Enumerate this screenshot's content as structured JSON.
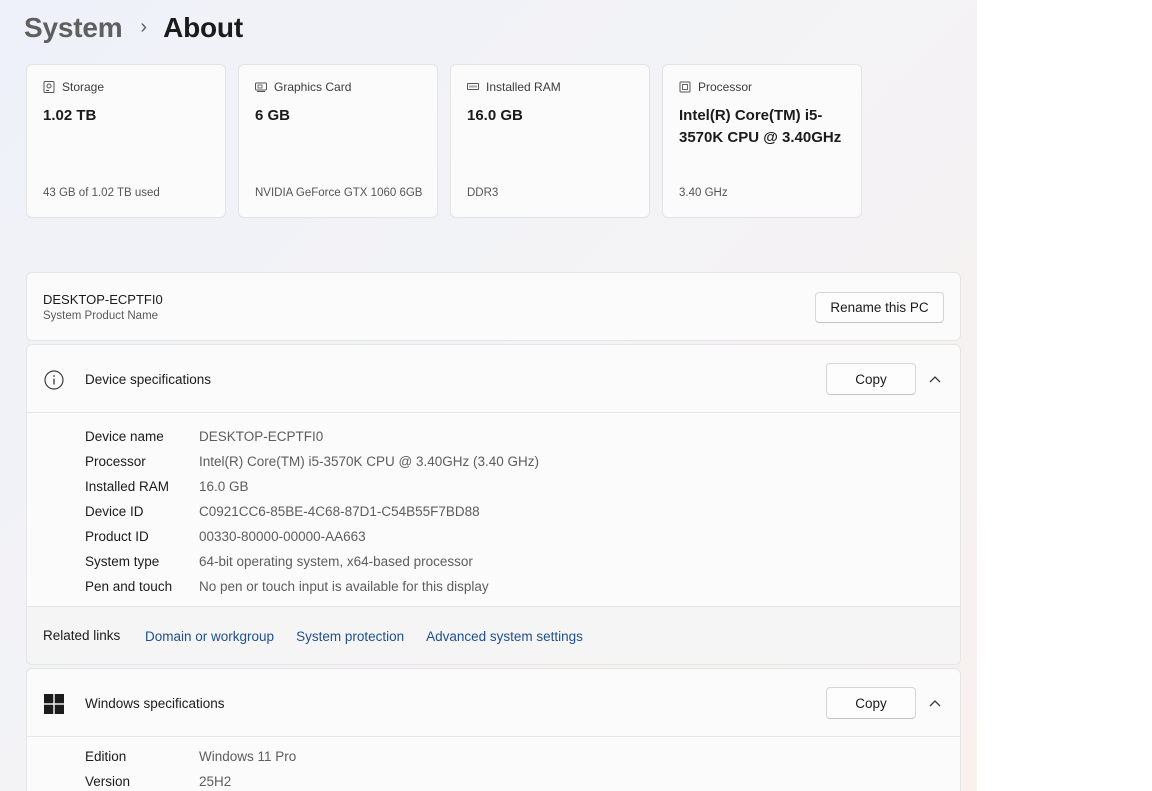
{
  "breadcrumb": {
    "parent": "System",
    "separator": "›",
    "current": "About"
  },
  "cards": [
    {
      "icon": "storage-icon",
      "label": "Storage",
      "value": "1.02 TB",
      "sub": "43 GB of 1.02 TB used"
    },
    {
      "icon": "graphics-card-icon",
      "label": "Graphics Card",
      "value": "6 GB",
      "sub": "NVIDIA GeForce GTX 1060 6GB"
    },
    {
      "icon": "ram-icon",
      "label": "Installed RAM",
      "value": "16.0 GB",
      "sub": "DDR3"
    },
    {
      "icon": "processor-icon",
      "label": "Processor",
      "value": "Intel(R) Core(TM) i5-3570K CPU @ 3.40GHz",
      "sub": "3.40 GHz"
    }
  ],
  "pc": {
    "name": "DESKTOP-ECPTFI0",
    "subtitle": "System Product Name",
    "rename_label": "Rename this PC"
  },
  "device_specs": {
    "title": "Device specifications",
    "copy_label": "Copy",
    "rows": [
      {
        "label": "Device name",
        "value": "DESKTOP-ECPTFI0"
      },
      {
        "label": "Processor",
        "value": "Intel(R) Core(TM) i5-3570K CPU @ 3.40GHz (3.40 GHz)"
      },
      {
        "label": "Installed RAM",
        "value": "16.0 GB"
      },
      {
        "label": "Device ID",
        "value": "C0921CC6-85BE-4C68-87D1-C54B55F7BD88"
      },
      {
        "label": "Product ID",
        "value": "00330-80000-00000-AA663"
      },
      {
        "label": "System type",
        "value": "64-bit operating system, x64-based processor"
      },
      {
        "label": "Pen and touch",
        "value": "No pen or touch input is available for this display"
      }
    ]
  },
  "related": {
    "title": "Related links",
    "links": [
      "Domain or workgroup",
      "System protection",
      "Advanced system settings"
    ]
  },
  "windows_specs": {
    "title": "Windows specifications",
    "copy_label": "Copy",
    "rows": [
      {
        "label": "Edition",
        "value": "Windows 11 Pro"
      },
      {
        "label": "Version",
        "value": "25H2"
      }
    ]
  },
  "colors": {
    "link": "#1d4f91",
    "text": "#1b1b1b",
    "secondary_text": "#5d5d5d"
  }
}
